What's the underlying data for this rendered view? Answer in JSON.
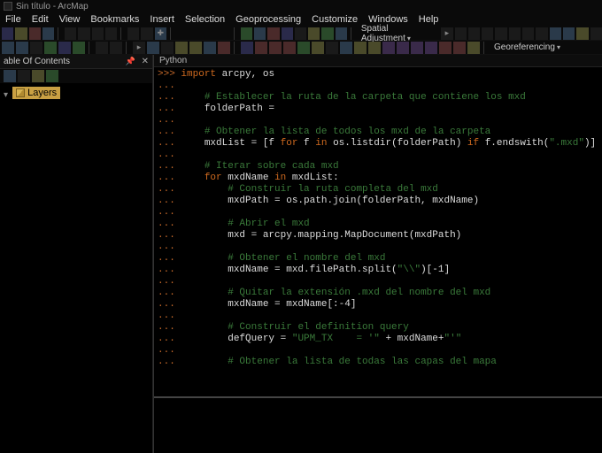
{
  "title": "Sin título - ArcMap",
  "menu": [
    "File",
    "Edit",
    "View",
    "Bookmarks",
    "Insert",
    "Selection",
    "Geoprocessing",
    "Customize",
    "Windows",
    "Help"
  ],
  "toolbar_labels": {
    "spatial_adjustment": "Spatial Adjustment",
    "georeferencing": "Georeferencing"
  },
  "toc": {
    "title": "able Of Contents",
    "root_node": "Layers"
  },
  "python": {
    "tab": "Python",
    "prompt_main": ">>>",
    "prompt_cont": "...",
    "lines": [
      {
        "p": ">>>",
        "pre": "",
        "kw": "import",
        "post": " arcpy, os"
      },
      {
        "p": "...",
        "text": ""
      },
      {
        "p": "...",
        "cm": "    # Establecer la ruta de la carpeta que contiene los mxd"
      },
      {
        "p": "...",
        "text": "    folderPath = "
      },
      {
        "p": "...",
        "text": ""
      },
      {
        "p": "...",
        "cm": "    # Obtener la lista de todos los mxd de la carpeta"
      },
      {
        "p": "...",
        "mxdlist": true
      },
      {
        "p": "...",
        "text": ""
      },
      {
        "p": "...",
        "cm": "    # Iterar sobre cada mxd"
      },
      {
        "p": "...",
        "forline": true
      },
      {
        "p": "...",
        "cm": "        # Construir la ruta completa del mxd"
      },
      {
        "p": "...",
        "text": "        mxdPath = os.path.join(folderPath, mxdName)"
      },
      {
        "p": "...",
        "text": ""
      },
      {
        "p": "...",
        "cm": "        # Abrir el mxd"
      },
      {
        "p": "...",
        "text": "        mxd = arcpy.mapping.MapDocument(mxdPath)"
      },
      {
        "p": "...",
        "text": ""
      },
      {
        "p": "...",
        "cm": "        # Obtener el nombre del mxd"
      },
      {
        "p": "...",
        "splitline": true
      },
      {
        "p": "...",
        "text": ""
      },
      {
        "p": "...",
        "cm": "        # Quitar la extensión .mxd del nombre del mxd"
      },
      {
        "p": "...",
        "text": "        mxdName = mxdName[:-4]"
      },
      {
        "p": "...",
        "text": ""
      },
      {
        "p": "...",
        "cm": "        # Construir el definition query"
      },
      {
        "p": "...",
        "defq": true
      },
      {
        "p": "...",
        "text": ""
      },
      {
        "p": "...",
        "cm": "        # Obtener la lista de todas las capas del mapa"
      }
    ],
    "strings": {
      "mxd_ext": "\".mxd\"",
      "backslash": "\"\\\\\"",
      "upm": "\"UPM_TX    = '\"",
      "tick": "\"'\""
    },
    "kw": {
      "for": "for",
      "in": "in",
      "if": "if",
      "import": "import"
    }
  }
}
